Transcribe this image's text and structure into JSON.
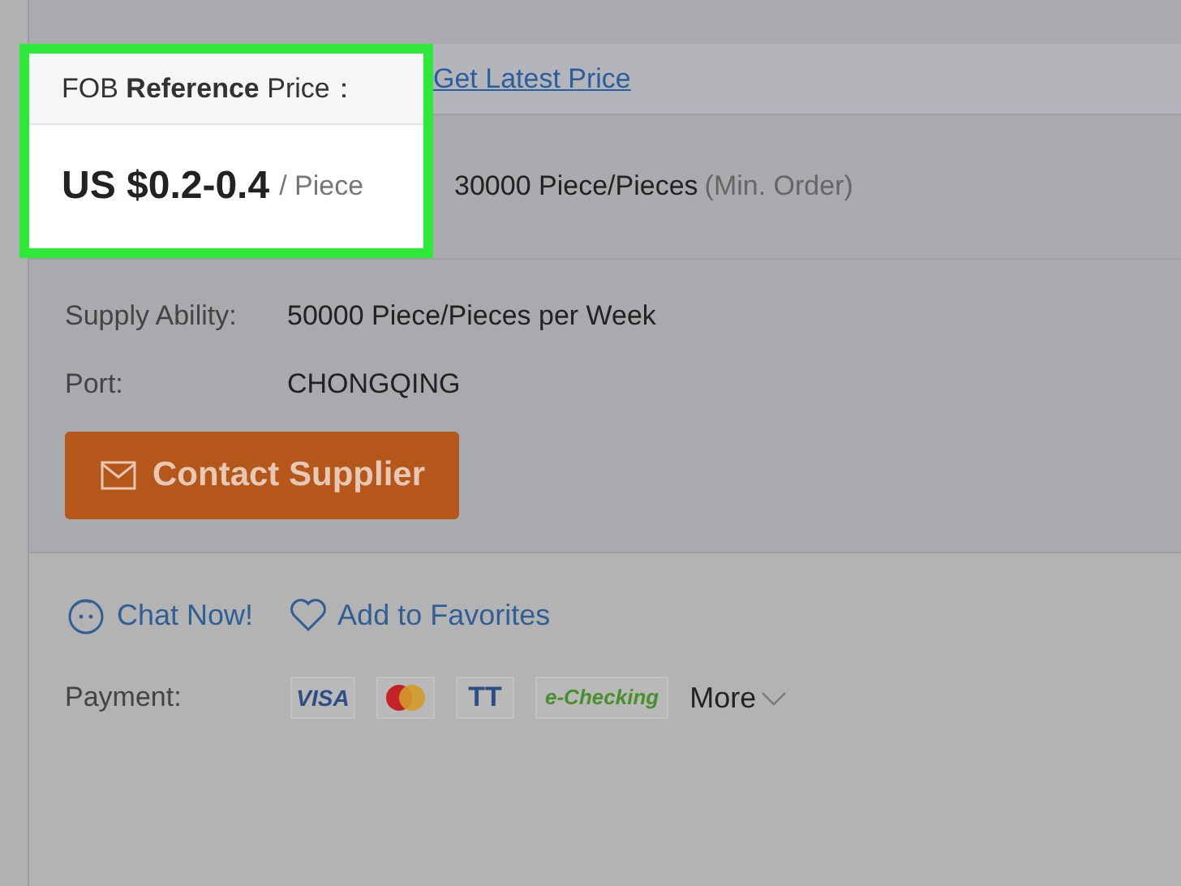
{
  "price_header": {
    "label": "FOB **Reference** Price：",
    "link": "Get Latest Price"
  },
  "price": {
    "amount": "US $0.2-0.4",
    "unit": "/ Piece",
    "highlighted": true
  },
  "min_order": {
    "quantity": "30000 Piece/Pieces",
    "note": "(Min. Order)"
  },
  "details": [
    {
      "label": "Supply Ability:",
      "value": "50000 Piece/Pieces per Week"
    },
    {
      "label": "Port:",
      "value": "CHONGQING"
    }
  ],
  "contact_button": "Contact Supplier",
  "actions": [
    {
      "kind": "chat",
      "label": "Chat Now!"
    },
    {
      "kind": "favorite",
      "label": "Add to Favorites"
    }
  ],
  "payment": {
    "label": "Payment:",
    "methods": [
      {
        "kind": "visa",
        "label": "VISA"
      },
      {
        "kind": "mastercard"
      },
      {
        "kind": "tt",
        "label": "TT"
      },
      {
        "kind": "echecking",
        "label": "e-Checking"
      }
    ],
    "more": "More"
  }
}
